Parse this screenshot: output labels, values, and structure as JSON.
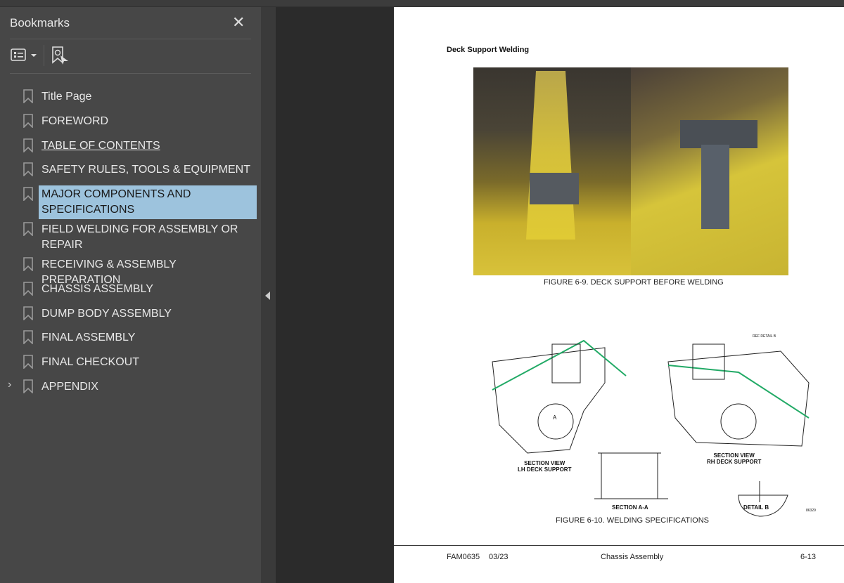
{
  "sidebar": {
    "title": "Bookmarks",
    "close_icon": "close-icon",
    "items": [
      {
        "label": "Title Page"
      },
      {
        "label": "FOREWORD"
      },
      {
        "label": "TABLE OF CONTENTS"
      },
      {
        "label": "SAFETY RULES, TOOLS & EQUIPMENT"
      },
      {
        "label": "MAJOR COMPONENTS AND SPECIFICATIONS",
        "selected": true
      },
      {
        "label": "FIELD WELDING FOR ASSEMBLY OR REPAIR"
      },
      {
        "label": "RECEIVING & ASSEMBLY PREPARATION"
      },
      {
        "label": "CHASSIS ASSEMBLY"
      },
      {
        "label": "DUMP BODY ASSEMBLY"
      },
      {
        "label": "FINAL ASSEMBLY"
      },
      {
        "label": "FINAL CHECKOUT"
      },
      {
        "label": "APPENDIX",
        "expandable": true
      }
    ],
    "selected_color": "#9dc3dd"
  },
  "page": {
    "heading": "Deck Support Welding",
    "figure1_caption": "FIGURE 6-9. DECK SUPPORT BEFORE WELDING",
    "figure2_caption": "FIGURE 6-10. WELDING SPECIFICATIONS",
    "labels": {
      "lh1": "SECTION VIEW",
      "lh2": "LH DECK SUPPORT",
      "rh1": "SECTION VIEW",
      "rh2": "RH DECK SUPPORT",
      "section": "SECTION A-A",
      "detail": "DETAIL B",
      "ref": "REF DETAIL B",
      "arrow_a": "A",
      "fig_id": "86329"
    },
    "footer": {
      "doc": "FAM0635",
      "date": "03/23",
      "section": "Chassis Assembly",
      "page": "6-13"
    }
  }
}
